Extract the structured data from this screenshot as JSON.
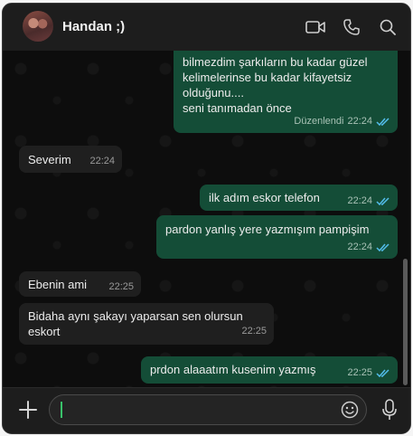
{
  "header": {
    "contact_name": "Handan ;)"
  },
  "messages": [
    {
      "dir": "out",
      "lines": [
        "bilmezdim şarkıların bu kadar güzel",
        "kelimelerinse bu kadar kifayetsiz",
        "olduğunu....",
        "seni tanımadan önce"
      ],
      "edited": "Düzenlendi",
      "time": "22:24",
      "read": true
    },
    {
      "dir": "in",
      "lines": [
        "Severim"
      ],
      "time": "22:24"
    },
    {
      "dir": "out",
      "lines": [
        "ilk adım eskor telefon"
      ],
      "time": "22:24",
      "read": true
    },
    {
      "dir": "out",
      "lines": [
        "pardon yanlış yere yazmışım pampişim"
      ],
      "time": "22:24",
      "read": true
    },
    {
      "dir": "in",
      "lines": [
        "Ebenin ami"
      ],
      "time": "22:25"
    },
    {
      "dir": "in",
      "lines": [
        "Bidaha aynı şakayı yaparsan sen olursun",
        "eskort"
      ],
      "time": "22:25"
    },
    {
      "dir": "out",
      "lines": [
        "prdon alaaatım kusenim yazmış"
      ],
      "time": "22:25",
      "read": true
    }
  ],
  "input": {
    "value": "",
    "placeholder": ""
  },
  "colors": {
    "outgoing": "#144d37",
    "incoming": "#1f1f1f",
    "read_check": "#53bdeb"
  },
  "icons": [
    "video-call-icon",
    "phone-icon",
    "search-icon",
    "plus-icon",
    "emoji-icon",
    "microphone-icon"
  ]
}
